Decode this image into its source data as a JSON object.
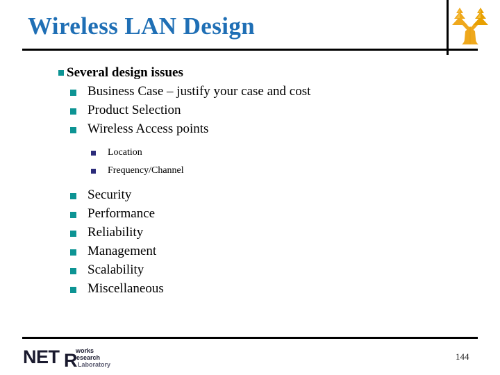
{
  "slide": {
    "title": "Wireless LAN Design",
    "title_color": "#1F6FB5",
    "page_number": "144",
    "background_color": "#ffffff",
    "bullet_color_level1": "#0D9494",
    "bullet_color_level2": "#0D9494",
    "bullet_color_level3": "#2B2B7A"
  },
  "logo": {
    "name": "tree-logo",
    "color_primary": "#F0A818",
    "color_secondary": "#E8A400",
    "color_light": "#F5C84A"
  },
  "content": {
    "items": [
      {
        "level": 1,
        "text": "Several design issues"
      },
      {
        "level": 2,
        "text": "Business Case – justify your case and cost"
      },
      {
        "level": 2,
        "text": "Product Selection"
      },
      {
        "level": 2,
        "text": "Wireless Access points"
      },
      {
        "level": 3,
        "text": "Location"
      },
      {
        "level": 3,
        "text": "Frequency/Channel"
      },
      {
        "level": 2,
        "text": "Security"
      },
      {
        "level": 2,
        "text": "Performance"
      },
      {
        "level": 2,
        "text": "Reliability"
      },
      {
        "level": 2,
        "text": "Management"
      },
      {
        "level": 2,
        "text": "Scalability"
      },
      {
        "level": 2,
        "text": "Miscellaneous"
      }
    ]
  },
  "footer": {
    "logo_part_net": "NET",
    "logo_part_r": "R",
    "logo_part_works": "works",
    "logo_part_esearch": "esearch",
    "logo_part_laboratory": "Laboratory"
  }
}
